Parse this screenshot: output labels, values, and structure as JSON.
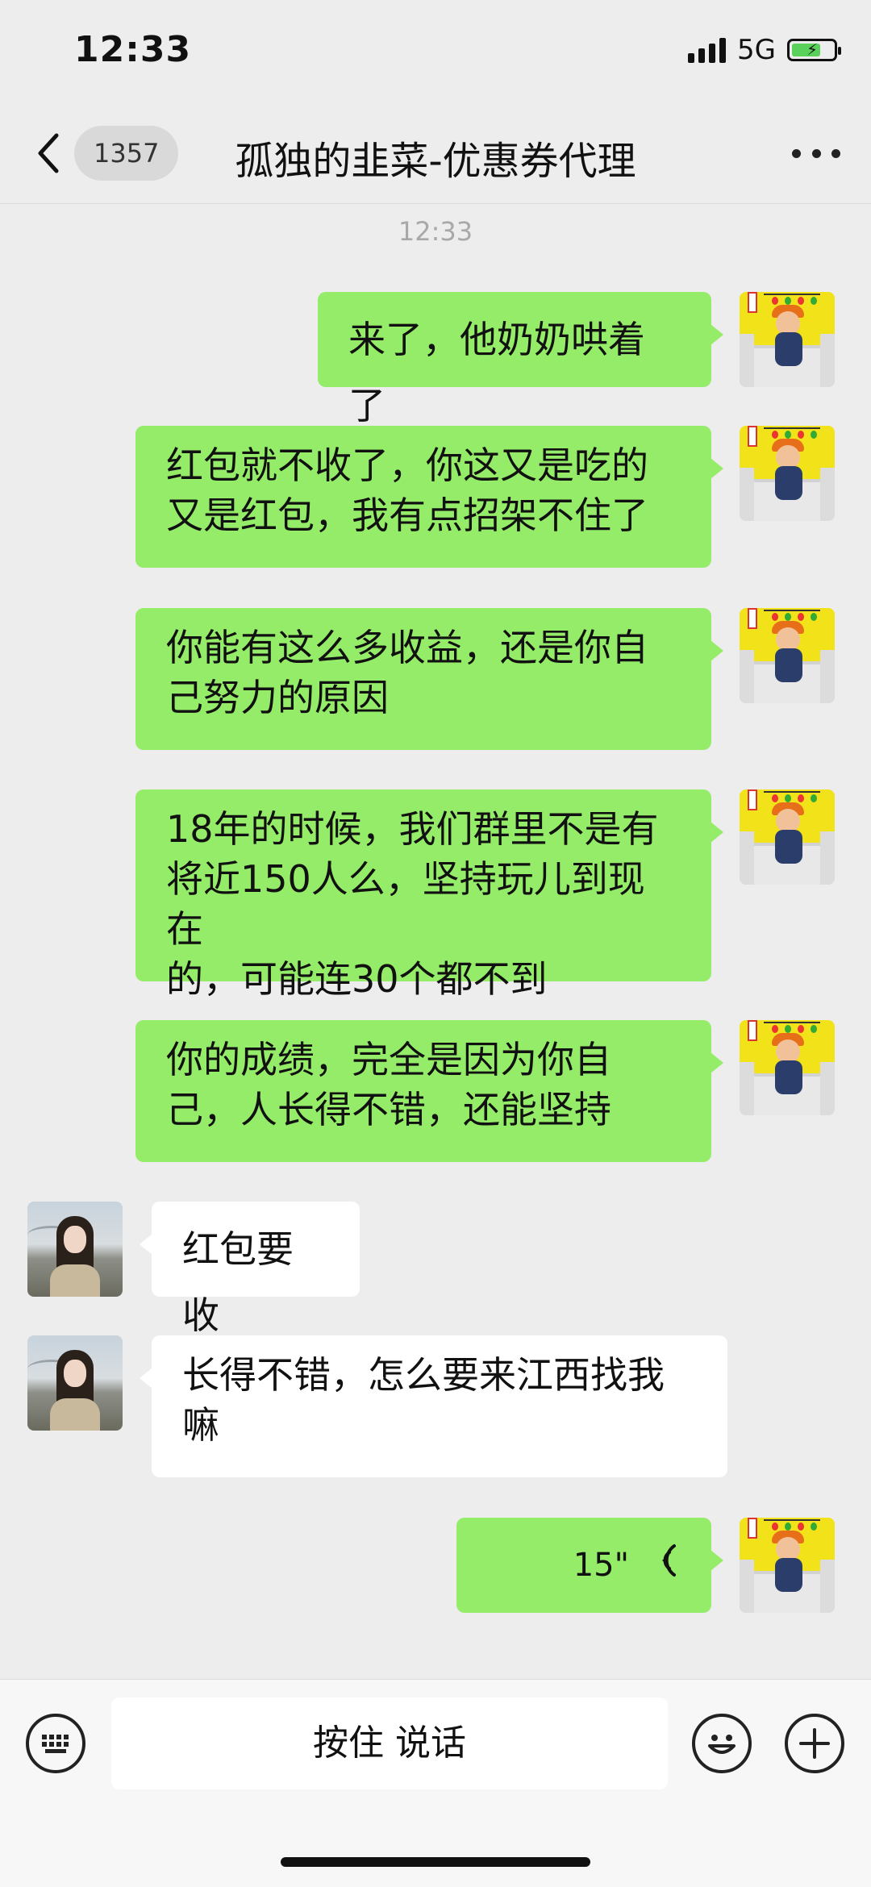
{
  "status_bar": {
    "time": "12:33",
    "network": "5G"
  },
  "header": {
    "unread_count": "1357",
    "title": "孤独的韭菜-优惠券代理"
  },
  "timestamp": "12:33",
  "messages": [
    {
      "from": "me",
      "text": "来了，他奶奶哄着了"
    },
    {
      "from": "me",
      "lines": [
        "红包就不收了，你这又是吃的",
        "又是红包，我有点招架不住了"
      ]
    },
    {
      "from": "me",
      "lines": [
        "你能有这么多收益，还是你自",
        "己努力的原因"
      ]
    },
    {
      "from": "me",
      "lines": [
        "18年的时候，我们群里不是有",
        "将近150人么，坚持玩儿到现在",
        "的，可能连30个都不到"
      ]
    },
    {
      "from": "me",
      "lines": [
        "你的成绩，完全是因为你自",
        "己，人长得不错，还能坚持"
      ]
    },
    {
      "from": "them",
      "text": "红包要收"
    },
    {
      "from": "them",
      "lines": [
        "长得不错，怎么要来江西找我",
        "嘛"
      ]
    },
    {
      "from": "me",
      "type": "voice",
      "duration": "15\""
    }
  ],
  "input_bar": {
    "hold_to_talk": "按住 说话"
  }
}
